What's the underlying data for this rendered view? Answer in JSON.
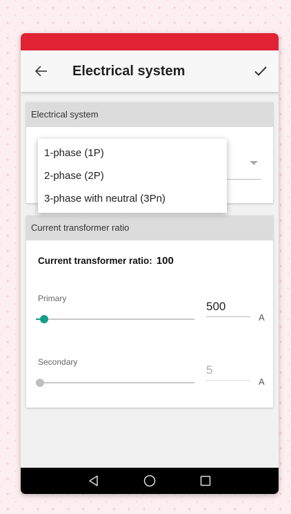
{
  "app_bar": {
    "title": "Electrical system"
  },
  "system_card": {
    "header": "Electrical system",
    "dropdown_options": [
      "1-phase (1P)",
      "2-phase (2P)",
      "3-phase with neutral (3Pn)"
    ]
  },
  "ct_card": {
    "header": "Current transformer ratio",
    "ratio_label": "Current transformer ratio:",
    "ratio_value": "100",
    "primary": {
      "label": "Primary",
      "value": "500",
      "unit": "A",
      "slider_fraction": 0.05
    },
    "secondary": {
      "label": "Secondary",
      "value": "5",
      "unit": "A",
      "slider_fraction": 0.0
    }
  },
  "colors": {
    "status_bar": "#e02233",
    "accent": "#169d8c",
    "disabled": "#c0c0c0"
  },
  "icons": {
    "back": "arrow-back-icon",
    "confirm": "check-icon",
    "nav_back": "nav-back-triangle-icon",
    "nav_home": "nav-home-circle-icon",
    "nav_recents": "nav-recents-square-icon"
  }
}
